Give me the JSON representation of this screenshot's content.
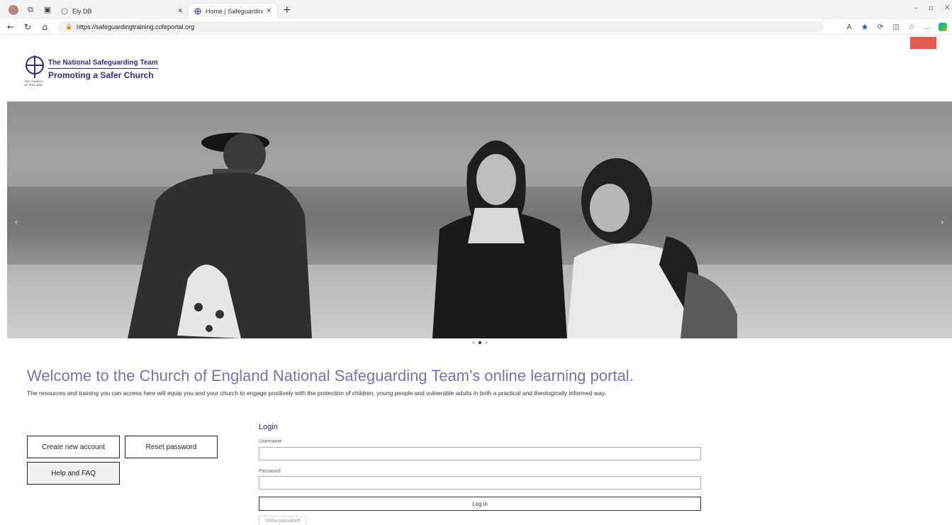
{
  "browser": {
    "tabs": [
      {
        "label": "Ely DB",
        "active": false
      },
      {
        "label": "Home | Safeguarding: Training Po",
        "active": true
      }
    ],
    "address": "https://safeguardingtraining.cofeportal.org",
    "accent": "#1a5ccc"
  },
  "header": {
    "logo_line1": "The National Safeguarding Team",
    "logo_line2": "Promoting a Safer Church",
    "logo_coe": "THE CHURCH OF ENGLAND",
    "red_button_color": "#e05a52"
  },
  "carousel": {
    "slide_count": 3,
    "active_index": 1
  },
  "main": {
    "welcome": "Welcome to the Church of England National Safeguarding Team's online learning portal.",
    "intro": "The resources and training you can access here will equip you and your church to engage positively with the protection of children, young people and vulnerable adults in both a practical and theologically informed way."
  },
  "actions": {
    "create_account": "Create new account",
    "reset_password": "Reset password",
    "help": "Help and FAQ"
  },
  "login": {
    "title": "Login",
    "username_label": "Username",
    "password_label": "Password",
    "login_button": "Log in",
    "show_password": "Show password"
  }
}
